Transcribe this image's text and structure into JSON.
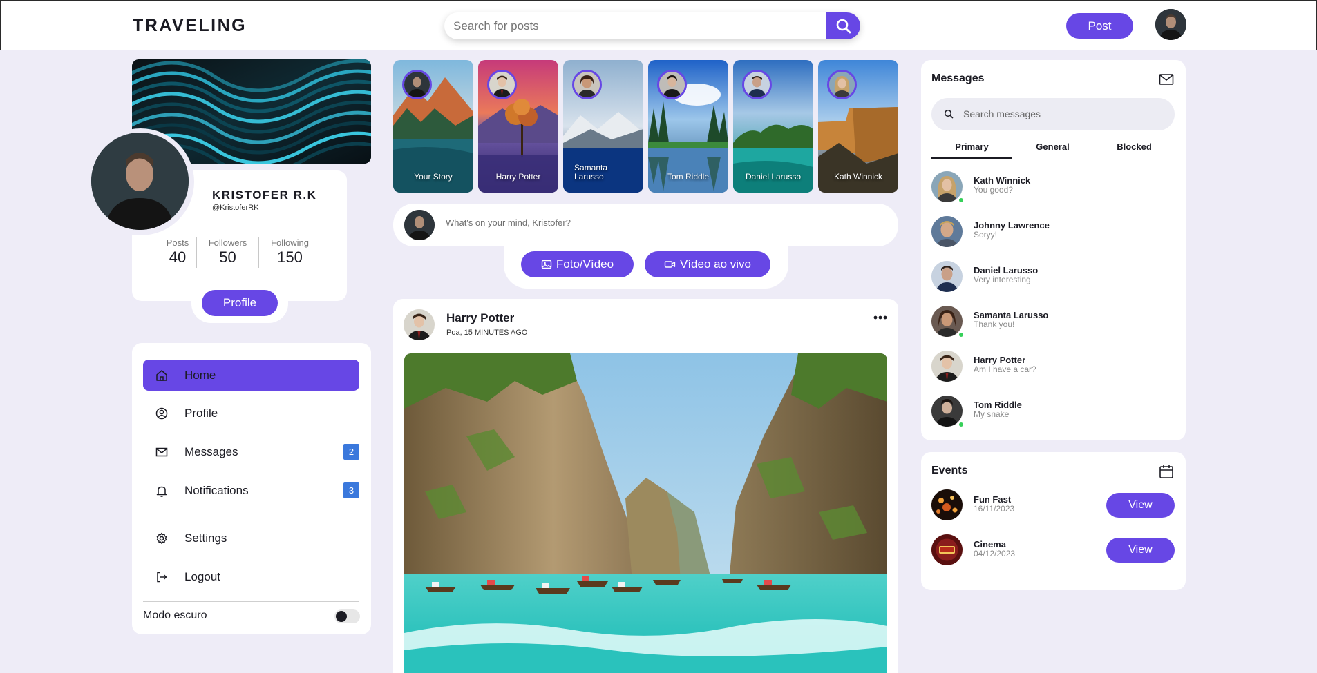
{
  "header": {
    "logo": "TRAVELING",
    "search_placeholder": "Search for posts",
    "post_label": "Post"
  },
  "profile": {
    "name": "KRISTOFER R.K",
    "handle": "@KristoferRK",
    "stats": [
      {
        "label": "Posts",
        "value": "40"
      },
      {
        "label": "Followers",
        "value": "50"
      },
      {
        "label": "Following",
        "value": "150"
      }
    ],
    "button_label": "Profile"
  },
  "menu": {
    "items": [
      {
        "label": "Home",
        "icon": "home-icon",
        "active": true
      },
      {
        "label": "Profile",
        "icon": "user-circle-icon"
      },
      {
        "label": "Messages",
        "icon": "envelope-icon",
        "badge": "2"
      },
      {
        "label": "Notifications",
        "icon": "bell-icon",
        "badge": "3"
      },
      {
        "label": "Settings",
        "icon": "gear-icon"
      },
      {
        "label": "Logout",
        "icon": "logout-icon"
      }
    ],
    "dark_mode_label": "Modo escuro",
    "dark_mode_on": false
  },
  "stories": [
    {
      "name": "Your Story"
    },
    {
      "name": "Harry Potter"
    },
    {
      "name": "Samanta Larusso"
    },
    {
      "name": "Tom Riddle"
    },
    {
      "name": "Daniel Larusso"
    },
    {
      "name": "Kath Winnick"
    }
  ],
  "compose": {
    "placeholder": "What's on your mind, Kristofer?",
    "photo_video_label": "Foto/Vídeo",
    "live_video_label": "Vídeo ao vivo"
  },
  "feed": {
    "author": "Harry Potter",
    "meta": "Poa, 15 MINUTES AGO"
  },
  "messages": {
    "title": "Messages",
    "search_placeholder": "Search messages",
    "tabs": [
      "Primary",
      "General",
      "Blocked"
    ],
    "active_tab": "Primary",
    "contacts": [
      {
        "name": "Kath Winnick",
        "message": "You good?",
        "online": true
      },
      {
        "name": "Johnny Lawrence",
        "message": "Soryy!",
        "online": false
      },
      {
        "name": "Daniel Larusso",
        "message": "Very interesting",
        "online": false
      },
      {
        "name": "Samanta Larusso",
        "message": "Thank you!",
        "online": true
      },
      {
        "name": "Harry Potter",
        "message": "Am I have a car?",
        "online": false
      },
      {
        "name": "Tom Riddle",
        "message": "My snake",
        "online": true
      }
    ]
  },
  "events": {
    "title": "Events",
    "items": [
      {
        "name": "Fun Fast",
        "date": "16/11/2023",
        "button": "View"
      },
      {
        "name": "Cinema",
        "date": "04/12/2023",
        "button": "View"
      }
    ]
  },
  "colors": {
    "accent": "#6747e5",
    "background": "#eeecf7",
    "badge": "#3a78dc",
    "online": "#37d05a"
  }
}
